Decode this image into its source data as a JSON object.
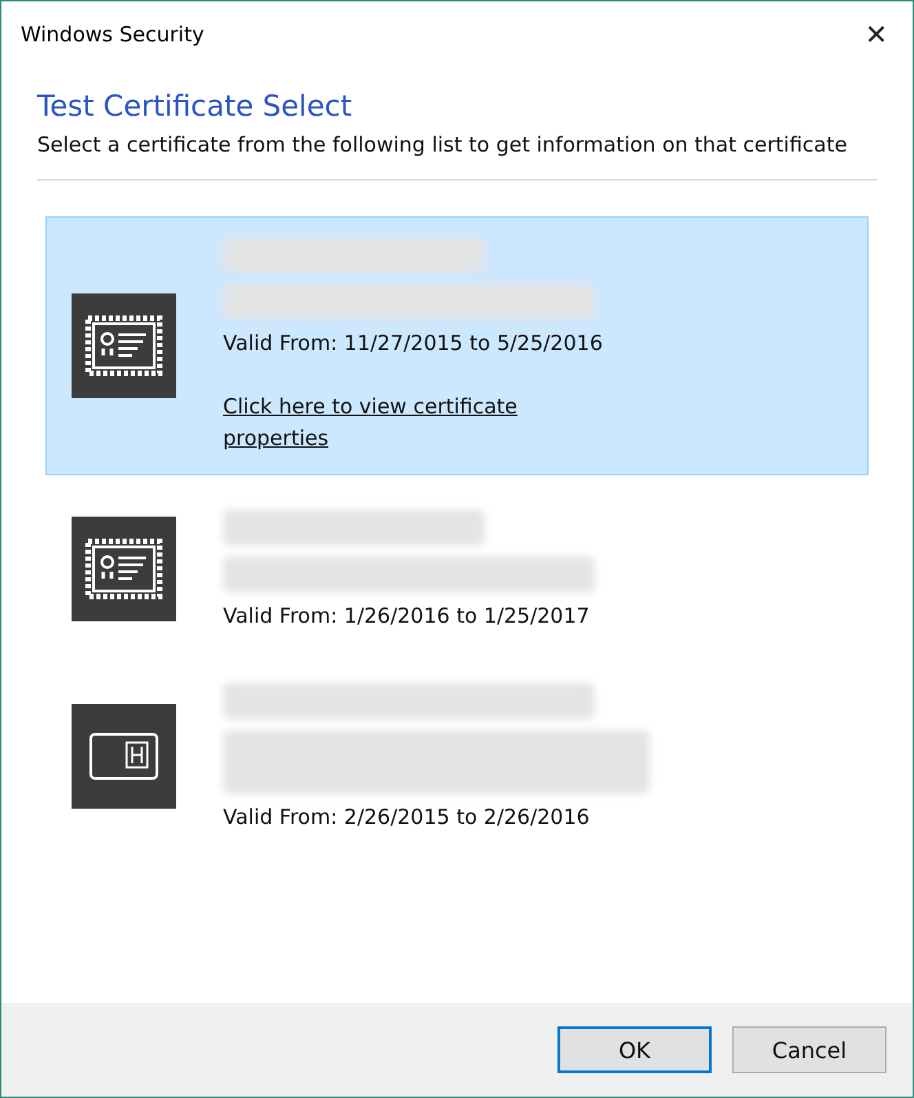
{
  "window": {
    "title": "Windows Security",
    "close": "✕"
  },
  "heading": "Test Certificate Select",
  "description": "Select a certificate from the following list to get information on that certificate",
  "certificates": [
    {
      "kind": "certificate",
      "selected": true,
      "redacted": [
        {
          "kind": "medium"
        },
        {
          "kind": "long"
        }
      ],
      "validity": "Valid From: 11/27/2015 to 5/25/2016",
      "link": "Click here to view certificate properties"
    },
    {
      "kind": "certificate",
      "selected": false,
      "redacted": [
        {
          "kind": "medium"
        },
        {
          "kind": "long"
        }
      ],
      "validity": "Valid From: 1/26/2016 to 1/25/2017"
    },
    {
      "kind": "smartcard",
      "selected": false,
      "redacted": [
        {
          "kind": "long"
        },
        {
          "kind": "wrapped"
        }
      ],
      "validity": "Valid From: 2/26/2015 to 2/26/2016"
    }
  ],
  "buttons": [
    {
      "label": "OK",
      "default": true
    },
    {
      "label": "Cancel",
      "default": false
    }
  ]
}
